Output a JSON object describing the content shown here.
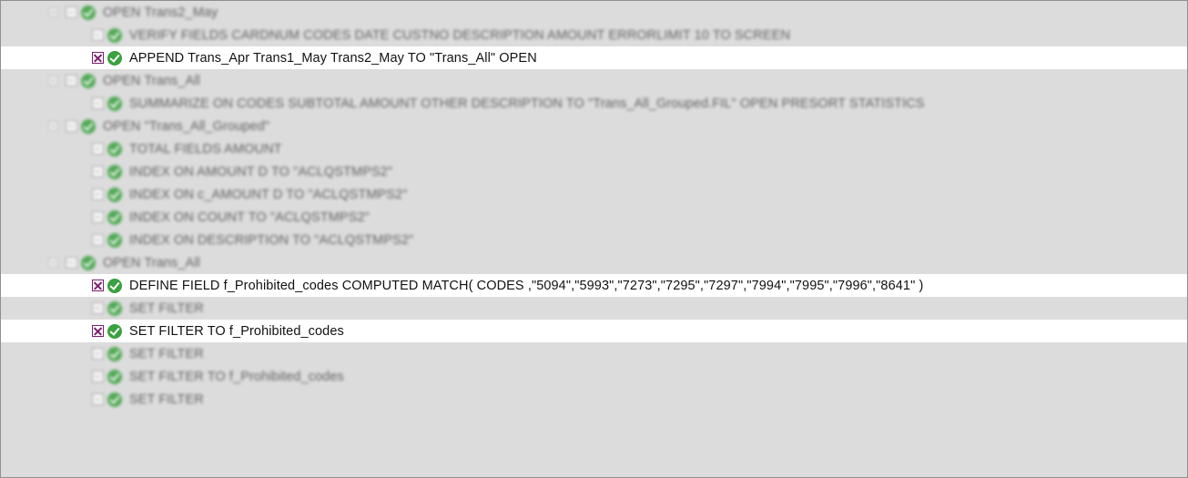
{
  "rows": [
    {
      "text": "OPEN Trans2_May"
    },
    {
      "text": "VERIFY FIELDS CARDNUM CODES DATE CUSTNO DESCRIPTION AMOUNT ERRORLIMIT 10 TO SCREEN"
    },
    {
      "text": "APPEND  Trans_Apr Trans1_May Trans2_May TO \"Trans_All\" OPEN"
    },
    {
      "text": "OPEN Trans_All"
    },
    {
      "text": "SUMMARIZE ON CODES SUBTOTAL AMOUNT OTHER DESCRIPTION TO \"Trans_All_Grouped.FIL\" OPEN PRESORT STATISTICS"
    },
    {
      "text": "OPEN \"Trans_All_Grouped\""
    },
    {
      "text": "TOTAL FIELDS AMOUNT"
    },
    {
      "text": "INDEX ON AMOUNT D TO \"ACLQSTMPS2\""
    },
    {
      "text": "INDEX ON c_AMOUNT D TO \"ACLQSTMPS2\""
    },
    {
      "text": "INDEX ON COUNT TO \"ACLQSTMPS2\""
    },
    {
      "text": "INDEX ON DESCRIPTION TO \"ACLQSTMPS2\""
    },
    {
      "text": "OPEN Trans_All"
    },
    {
      "text": "DEFINE FIELD f_Prohibited_codes COMPUTED MATCH( CODES ,\"5094\",\"5993\",\"7273\",\"7295\",\"7297\",\"7994\",\"7995\",\"7996\",\"8641\" )"
    },
    {
      "text": "SET FILTER"
    },
    {
      "text": "SET FILTER TO f_Prohibited_codes"
    },
    {
      "text": "SET FILTER"
    },
    {
      "text": "SET FILTER TO f_Prohibited_codes"
    },
    {
      "text": "SET FILTER"
    }
  ]
}
